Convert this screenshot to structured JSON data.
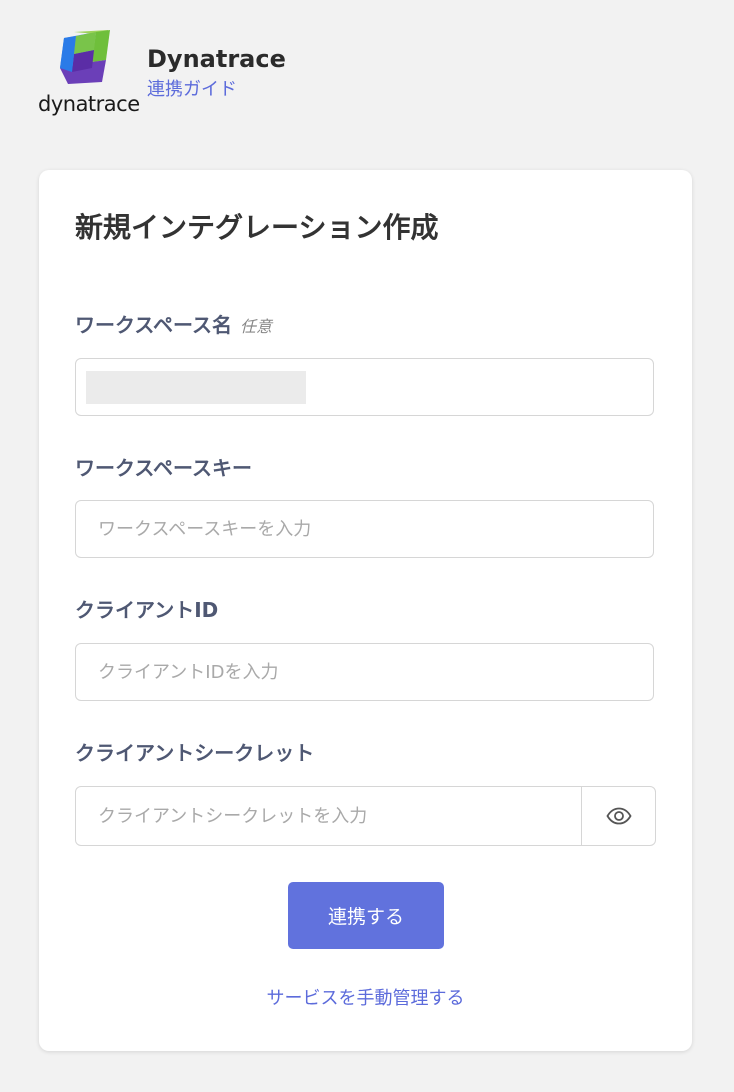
{
  "header": {
    "logo_text": "dynatrace",
    "app_name": "Dynatrace",
    "guide_link": "連携ガイド"
  },
  "form": {
    "title": "新規インテグレーション作成",
    "workspace_name": {
      "label": "ワークスペース名",
      "optional_tag": "任意",
      "value": ""
    },
    "workspace_key": {
      "label": "ワークスペースキー",
      "placeholder": "ワークスペースキーを入力"
    },
    "client_id": {
      "label": "クライアントID",
      "placeholder": "クライアントIDを入力"
    },
    "client_secret": {
      "label": "クライアントシークレット",
      "placeholder": "クライアントシークレットを入力",
      "toggle_icon": "eye-icon"
    },
    "submit_label": "連携する",
    "manual_link": "サービスを手動管理する"
  },
  "colors": {
    "accent": "#6172dd",
    "link": "#5c6bdb",
    "label": "#4f5873",
    "background": "#f2f2f2"
  }
}
